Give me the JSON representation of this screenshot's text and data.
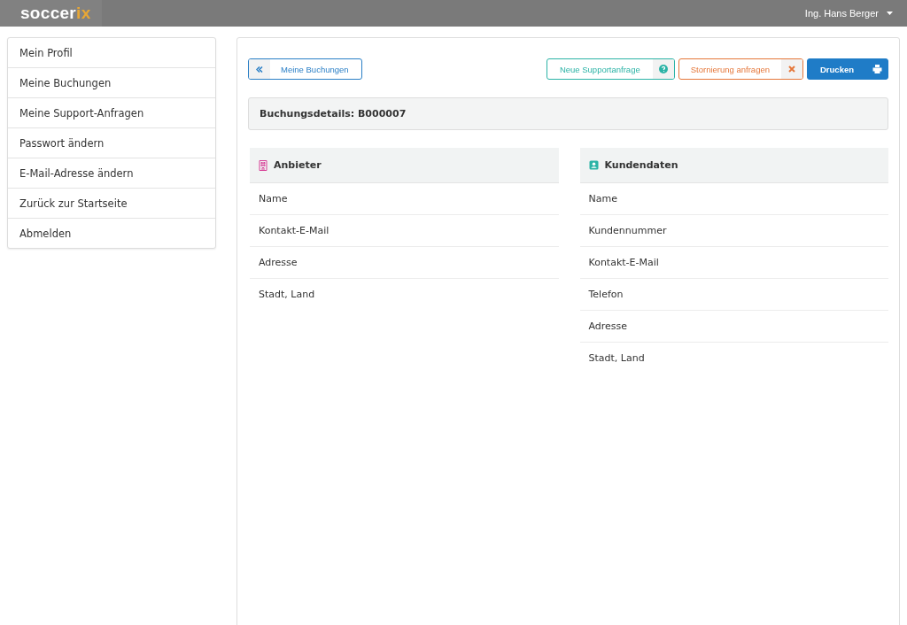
{
  "header": {
    "logo": {
      "text": "soccer",
      "accent": "ix"
    },
    "user": "Ing. Hans Berger"
  },
  "sidebar": {
    "items": [
      {
        "label": "Mein Profil"
      },
      {
        "label": "Meine Buchungen"
      },
      {
        "label": "Meine Support-Anfragen"
      },
      {
        "label": "Passwort ändern"
      },
      {
        "label": "E-Mail-Adresse ändern"
      },
      {
        "label": "Zurück zur Startseite"
      },
      {
        "label": "Abmelden"
      }
    ]
  },
  "back_button": {
    "label": "Meine Buchungen"
  },
  "actions": [
    {
      "label": "Neue Supportanfrage",
      "kind": "support"
    },
    {
      "label": "Stornierung anfragen",
      "kind": "cancel"
    },
    {
      "label": "Drucken",
      "kind": "print"
    }
  ],
  "details_title": "Buchungsdetails: B000007",
  "panels": [
    {
      "title": "Anbieter",
      "kind": "provider",
      "rows": [
        "Name",
        "Kontakt-E-Mail",
        "Adresse",
        "Stadt, Land"
      ]
    },
    {
      "title": "Kundendaten",
      "kind": "customer",
      "rows": [
        "Name",
        "Kundennummer",
        "Kontakt-E-Mail",
        "Telefon",
        "Adresse",
        "Stadt, Land"
      ]
    }
  ]
}
